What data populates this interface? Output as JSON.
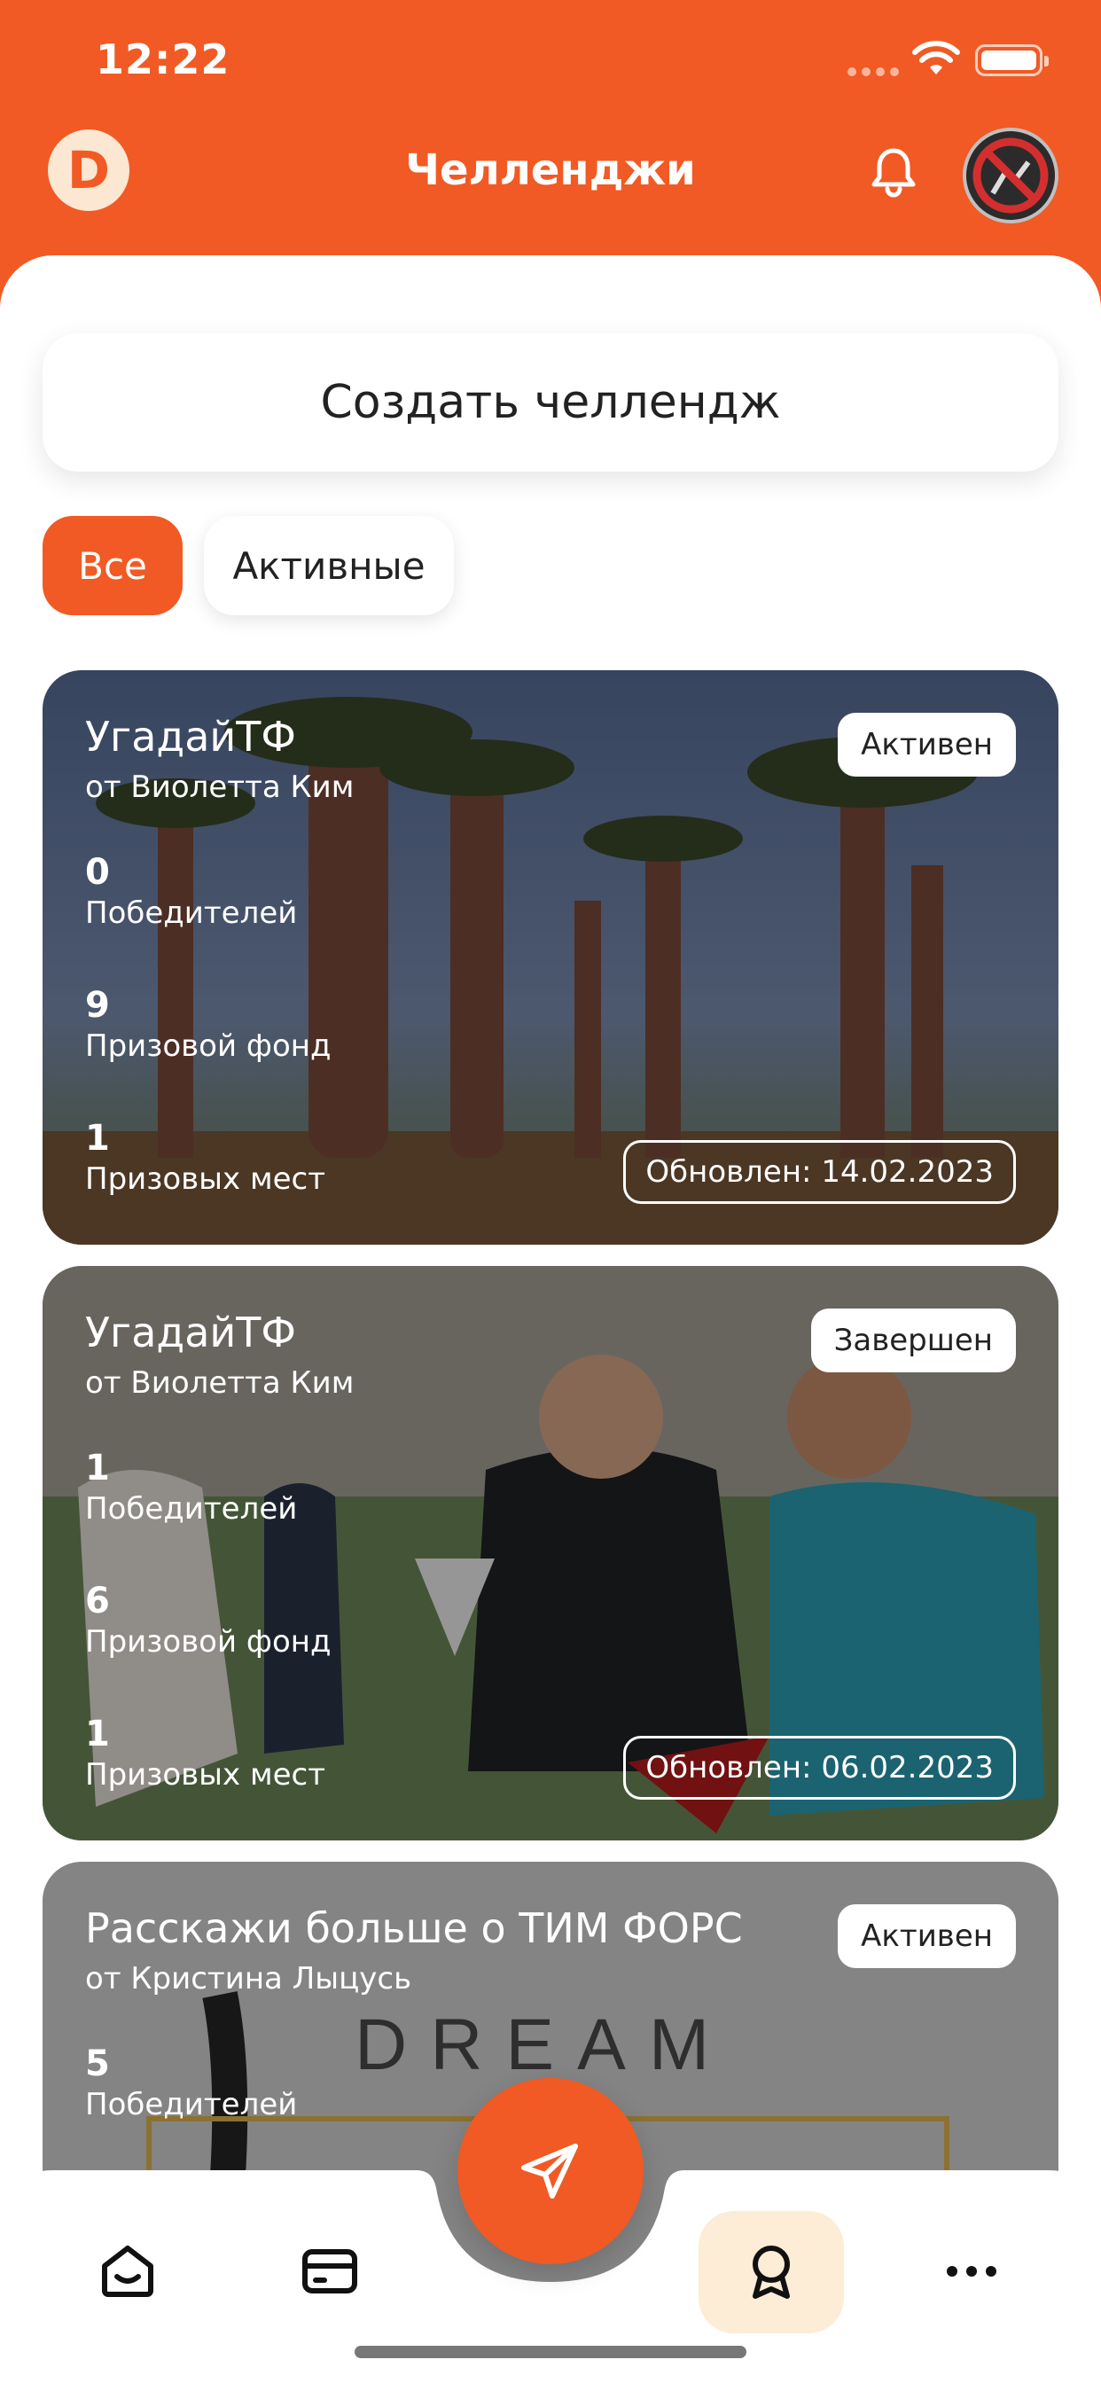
{
  "status_bar": {
    "time": "12:22"
  },
  "header": {
    "title": "Челленджи",
    "logo_letter": "D"
  },
  "create_button": {
    "label": "Создать челлендж"
  },
  "filters": {
    "all": "Все",
    "active": "Активные"
  },
  "cards": [
    {
      "title": "УгадайТФ",
      "author": "от Виолетта Ким",
      "status": "Активен",
      "winners_value": "0",
      "winners_label": "Победителей",
      "prize_value": "9",
      "prize_label": "Призовой фонд",
      "places_value": "1",
      "places_label": "Призовых мест",
      "updated": "Обновлен: 14.02.2023"
    },
    {
      "title": "УгадайТФ",
      "author": "от Виолетта Ким",
      "status": "Завершен",
      "winners_value": "1",
      "winners_label": "Победителей",
      "prize_value": "6",
      "prize_label": "Призовой фонд",
      "places_value": "1",
      "places_label": "Призовых мест",
      "updated": "Обновлен: 06.02.2023"
    },
    {
      "title": "Расскажи больше о ТИМ ФОРС",
      "author": "от Кристина Лыцусь",
      "status": "Активен",
      "winners_value": "5",
      "winners_label": "Победителей",
      "image_text": "DREAM"
    }
  ],
  "tabbar": {
    "items": [
      "home-icon",
      "card-icon",
      "send-icon",
      "award-icon",
      "more-icon"
    ],
    "active": "award-icon"
  },
  "colors": {
    "accent": "#f15a24",
    "active_tab_bg": "#fdecd6"
  }
}
